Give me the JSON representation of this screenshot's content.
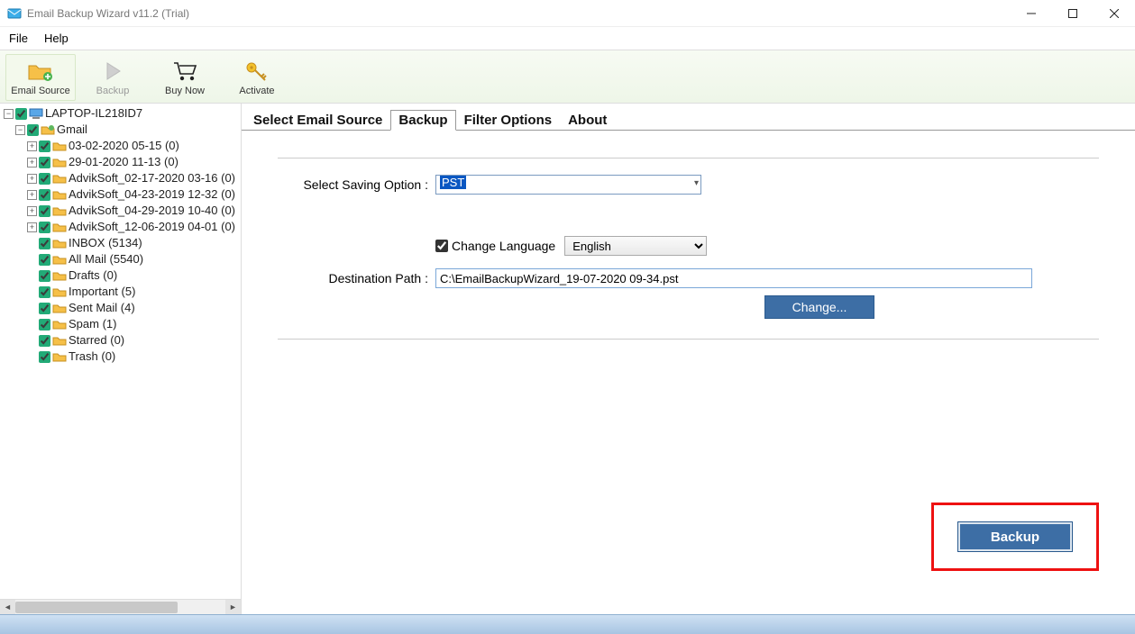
{
  "window": {
    "title": "Email Backup Wizard v11.2 (Trial)"
  },
  "menu": {
    "file": "File",
    "help": "Help"
  },
  "toolbar": {
    "email_source": "Email Source",
    "backup": "Backup",
    "buy_now": "Buy Now",
    "activate": "Activate"
  },
  "tree": {
    "root": "LAPTOP-IL218ID7",
    "account": "Gmail",
    "folders": [
      "03-02-2020 05-15 (0)",
      "29-01-2020 11-13 (0)",
      "AdvikSoft_02-17-2020 03-16 (0)",
      "AdvikSoft_04-23-2019 12-32 (0)",
      "AdvikSoft_04-29-2019 10-40 (0)",
      "AdvikSoft_12-06-2019 04-01 (0)"
    ],
    "mailboxes": [
      "INBOX (5134)",
      "All Mail (5540)",
      "Drafts (0)",
      "Important (5)",
      "Sent Mail (4)",
      "Spam (1)",
      "Starred (0)",
      "Trash (0)"
    ]
  },
  "tabs": {
    "source": "Select Email Source",
    "backup": "Backup",
    "filter": "Filter Options",
    "about": "About"
  },
  "form": {
    "saving_label": "Select Saving Option  :",
    "saving_value": "PST",
    "change_lang_label": "Change Language",
    "lang_value": "English",
    "dest_label": "Destination Path  :",
    "dest_value": "C:\\EmailBackupWizard_19-07-2020 09-34.pst",
    "change_btn": "Change...",
    "backup_btn": "Backup"
  }
}
